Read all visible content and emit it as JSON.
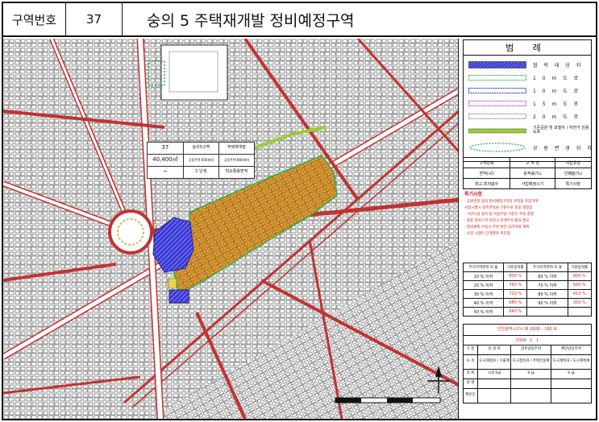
{
  "header": {
    "label_district_no": "구역번호",
    "district_no": "37",
    "title": "숭의 5 주택재개발 정비예정구역"
  },
  "map_table": {
    "r1": [
      "37",
      "숭의5구역",
      "주택재개발"
    ],
    "r2": [
      "40,400㎡",
      "공동주택 600세대",
      "공동주택 860세대"
    ],
    "r3": [
      "~",
      "1 단계",
      "학교활용면적"
    ]
  },
  "legend": {
    "title": "범 례",
    "items": [
      {
        "label": "협 의 대 상 지",
        "color": "#3a3ad8",
        "pattern": "hatch"
      },
      {
        "label": "1 0 m  도  로",
        "color": "#2bb34a",
        "pattern": "dashes"
      },
      {
        "label": "1 0 m  도  로",
        "color": "#2a2ab0",
        "pattern": "dashes"
      },
      {
        "label": "1 5 m  도  로",
        "color": "#c23bd0",
        "pattern": "dashes"
      },
      {
        "label": "2 0 m  도  로",
        "color": "#888888",
        "pattern": "dashes"
      },
      {
        "label": "기존공원 및 보행자 / 자전거 전용도로",
        "color": "#9acd32",
        "pattern": "solid"
      },
      {
        "label": "공 원 변 경 위 치",
        "color": "#2bb34a",
        "pattern": "ellipse"
      }
    ]
  },
  "info_box": {
    "r1": [
      "구역번호",
      "구 역 명",
      "사업유형"
    ],
    "r2": [
      "면적(㎡)",
      "용적률(%)",
      "건폐율(%)"
    ],
    "r3": [
      "최고,최저층수",
      "사업예정시기",
      "특기사항"
    ]
  },
  "notes": {
    "title": "특기사항",
    "lines": [
      "· 공원면적 협의 정비예정구역의 면적을 포함하며",
      "  사업시행시 실측면적을 기준으로 최종 결정함",
      "· 기반시설 설치 등 비용부담 기준은 추후 결정",
      "· 향후 정비구역 지정시 관계부서 협의 필요",
      "· 정비계획 수립시 주변 여건 고려하여 계획",
      "· 사업 시행은 단계별로 추진함"
    ]
  },
  "far_table": {
    "headers": [
      "주거지역면적 비 율",
      "기준용적률",
      "주거지역면적 비 율",
      "기준용적률"
    ],
    "rows": [
      [
        "10 % 이하",
        "800 %",
        "60 % 이하",
        "600 %"
      ],
      [
        "20 % 이하",
        "760 %",
        "70 % 이하",
        "560 %"
      ],
      [
        "30 % 이하",
        "720 %",
        "80 % 이하",
        "410 %"
      ],
      [
        "40 % 이하",
        "680 %",
        "90 % 이하",
        "350 %"
      ],
      [
        "50 % 이하",
        "640 %",
        "",
        ""
      ]
    ]
  },
  "plan": {
    "line1": "인천광역시고시 제 2008 – 180 호",
    "line2": "2008 .  5 .  1"
  },
  "signatures": {
    "header": [
      "구 분",
      "의 견 자",
      "검토담당부서",
      "확인담당부서"
    ],
    "rows": [
      [
        "소 속",
        "도시재생과 / 기술계",
        "도시정비과 / 주택건설계",
        "도시계획과 / 도시계획계"
      ],
      [
        "직 위",
        "시설 6급",
        "6 급",
        "6 급"
      ],
      [
        "성 명",
        "",
        "",
        ""
      ],
      [
        "확인인",
        "",
        "",
        ""
      ]
    ]
  },
  "colors": {
    "road": "#c23232",
    "block_fill": "#f4f4f4",
    "district_fill": "#e6a53a",
    "consultation": "#3a3ad8",
    "park": "#2bb34a"
  }
}
